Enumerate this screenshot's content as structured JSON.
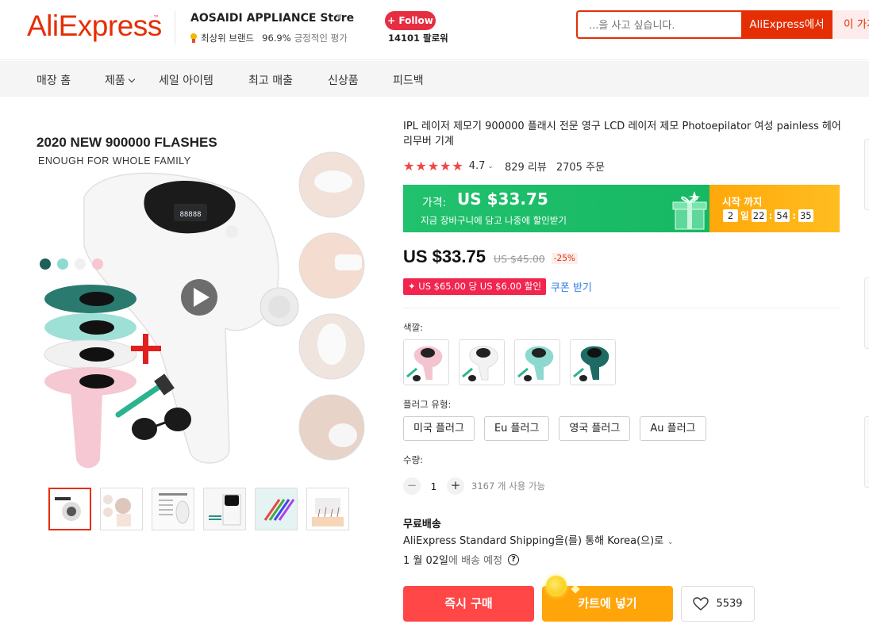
{
  "header": {
    "logo": "AliExpress",
    "logo_tm": "™",
    "store": {
      "name": "AOSAIDI APPLIANCE Store",
      "badge": "최상위 브랜드",
      "positive_value": "96.9%",
      "positive_label": "긍정적인 평가",
      "follow_label": "+ Follow",
      "followers": "14101 팔로워"
    },
    "search": {
      "placeholder": "...을 사고 싶습니다.",
      "button_aliexpress": "AliExpress에서",
      "button_store": "이 가게에서"
    }
  },
  "nav": {
    "items": [
      "매장 홈",
      "제품",
      "세일 아이템",
      "최고 매출",
      "신상품",
      "피드백"
    ]
  },
  "gallery": {
    "headline": "2020 NEW 900000 FLASHES",
    "subline": "ENOUGH FOR WHOLE FAMILY",
    "device_display": "88888"
  },
  "product": {
    "title": "IPL 레이저 제모기 900000 플래시 전문 영구 LCD 레이저 제모 Photoepilator 여성 painless 헤어 리무버 기계",
    "stars": "★★★★★",
    "rating": "4.7",
    "reviews": "829 리뷰",
    "orders": "2705 주문"
  },
  "promo": {
    "price_label": "가격:",
    "price": "US $33.75",
    "subtitle": "지금 장바구니에 담고 나중에 할인받기",
    "start_label": "시작 까지",
    "countdown": {
      "days": "2",
      "days_unit": "일",
      "hours": "22",
      "minutes": "54",
      "seconds": "35"
    }
  },
  "price": {
    "current": "US $33.75",
    "original": "US $45.00",
    "discount": "-25%"
  },
  "coupon": {
    "label": "✦ US $65.00 당 US $6.00 할인",
    "link": "쿠폰 받기"
  },
  "options": {
    "color_label": "색깔:",
    "plug_label": "플러그 유형:",
    "plugs": [
      "미국 플러그",
      "Eu 플러그",
      "영국 플러그",
      "Au 플러그"
    ],
    "swatch_colors": [
      "#f3c4cf",
      "#f2f2f2",
      "#8ed9cf",
      "#1d6b64"
    ]
  },
  "quantity": {
    "label": "수량:",
    "minus": "−",
    "value": "1",
    "plus": "+",
    "available": "3167 개 사용 가능"
  },
  "shipping": {
    "title": "무료배송",
    "line": "AliExpress Standard Shipping을(를) 통해 Korea(으)로",
    "eta_date": "1 월 02일",
    "eta_rest": "에 배송 예정"
  },
  "actions": {
    "buy": "즉시 구매",
    "cart": "카트에 넣기",
    "wishlist_count": "5539"
  },
  "colors": {
    "brand_red": "#e62e04",
    "promo_green": "#21c16d",
    "promo_orange": "#ffa80a",
    "buy_red": "#ff4747",
    "cart_orange": "#ffa50a"
  }
}
